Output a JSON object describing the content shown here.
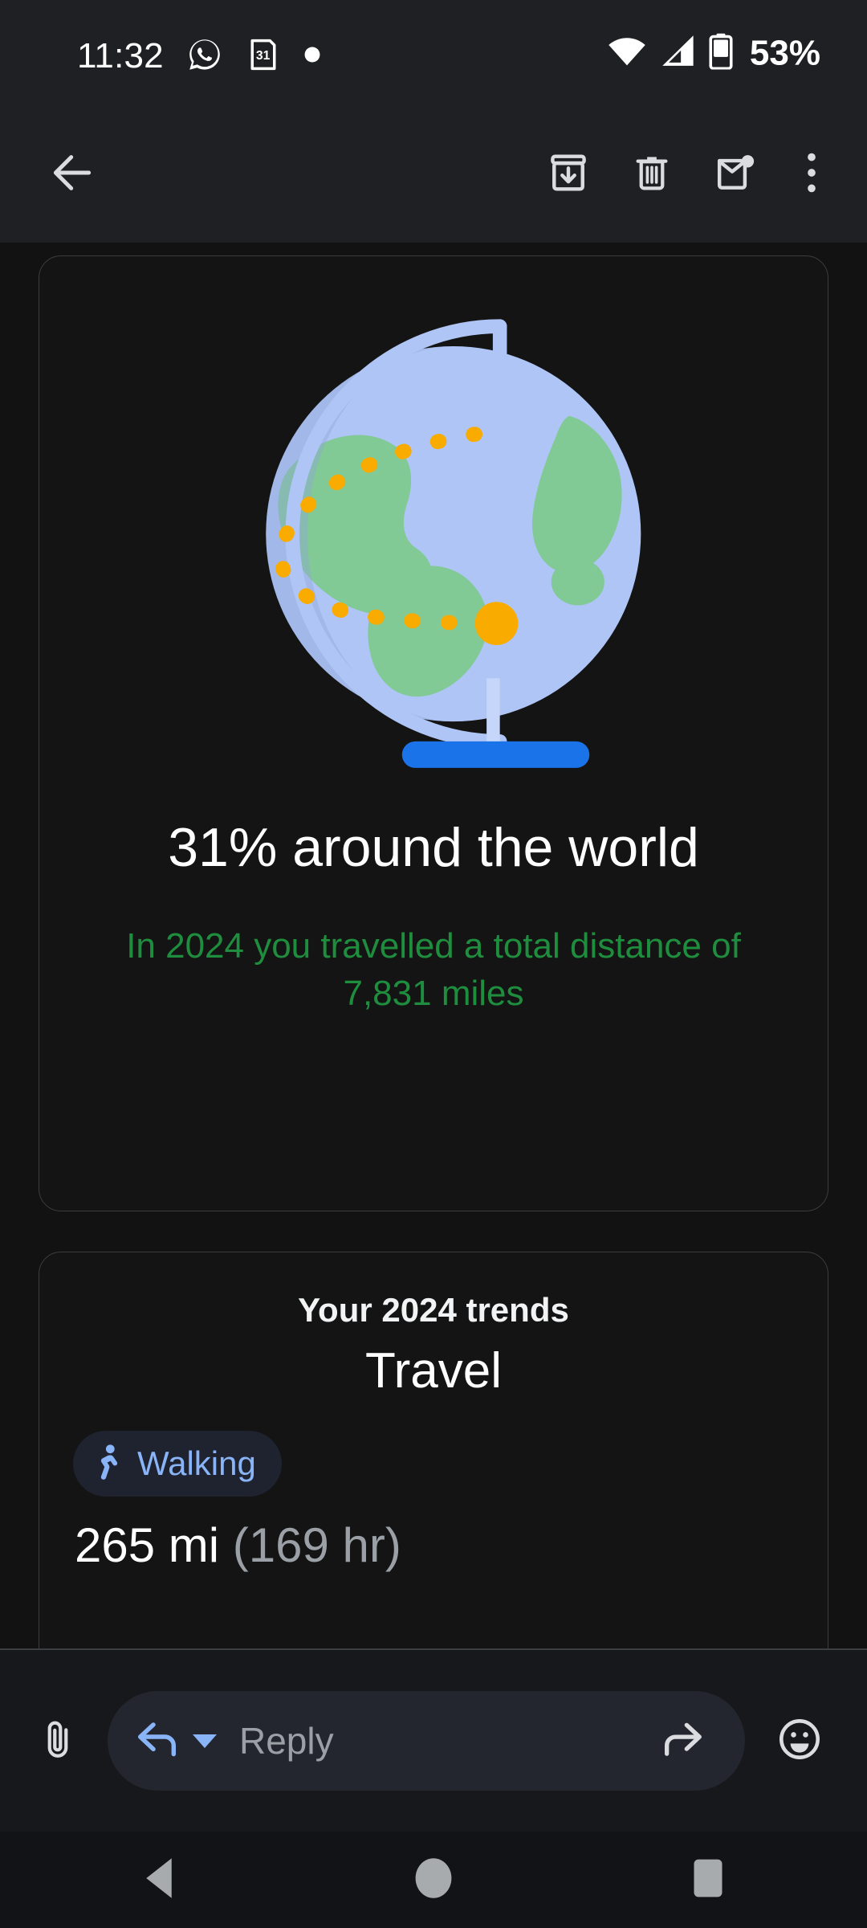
{
  "status_bar": {
    "time": "11:32",
    "battery_percent": "53%",
    "icons": [
      "whatsapp-icon",
      "calendar-icon",
      "notification-dot-icon",
      "wifi-icon",
      "cellular-signal-icon",
      "battery-icon"
    ],
    "calendar_day": "31"
  },
  "toolbar": {
    "back_label": "back-arrow-icon",
    "actions": [
      {
        "name": "archive-button",
        "icon": "archive-icon"
      },
      {
        "name": "delete-button",
        "icon": "trash-icon"
      },
      {
        "name": "mark-unread-button",
        "icon": "mail-unread-icon"
      },
      {
        "name": "overflow-menu-button",
        "icon": "more-vert-icon"
      }
    ]
  },
  "summary_card": {
    "illustration": "globe-on-stand-with-dotted-travel-path-icon",
    "headline": "31% around the world",
    "subline": "In 2024 you travelled a total distance of 7,831 miles",
    "percent_value": "31%",
    "distance_value": "7,831 miles",
    "year": "2024",
    "headline_color": "#ffffff",
    "subline_color": "#1e8e3e"
  },
  "trends_card": {
    "eyebrow": "Your 2024 trends",
    "title": "Travel",
    "chip": {
      "label": "Walking",
      "icon": "walking-person-icon",
      "text_color": "#8ab4f8",
      "background_color": "#1f2330"
    },
    "stat_primary": "265 mi",
    "stat_secondary": " (169 hr)"
  },
  "reply_bar": {
    "attach_icon": "paperclip-icon",
    "reply_icon": "reply-arrow-icon",
    "dropdown_icon": "caret-down-icon",
    "placeholder": "Reply",
    "forward_icon": "forward-arrow-icon",
    "emoji_icon": "emoji-face-icon"
  },
  "nav_bar": {
    "back": "nav-back-triangle-icon",
    "home": "nav-home-circle-icon",
    "recents": "nav-recents-square-icon"
  },
  "theme": {
    "background": "#121212",
    "chrome": "#1f2023",
    "card_border": "#3b3d40",
    "accent_blue": "#8ab4f8",
    "accent_green": "#1e8e3e",
    "globe_blue": "#aec5f5",
    "globe_green": "#81c995",
    "globe_base": "#1a73e8",
    "path_orange": "#f9ab00"
  }
}
